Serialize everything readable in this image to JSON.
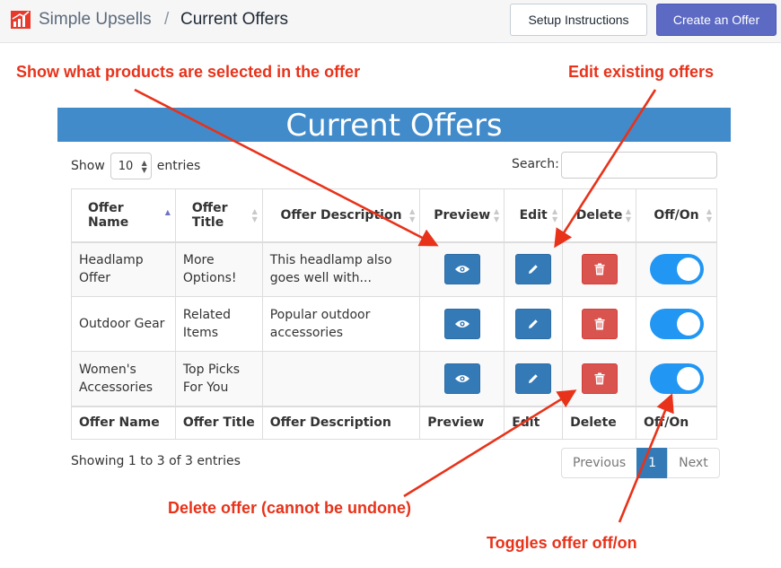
{
  "header": {
    "brand": "Simple Upsells",
    "separator": "/",
    "page_title": "Current Offers",
    "setup_label": "Setup Instructions",
    "create_label": "Create an Offer"
  },
  "banner": {
    "title": "Current Offers"
  },
  "controls": {
    "show_label": "Show",
    "page_length": "10",
    "entries_label": "entries",
    "search_label": "Search:",
    "search_value": ""
  },
  "table": {
    "headers": [
      "Offer Name",
      "Offer Title",
      "Offer Description",
      "Preview",
      "Edit",
      "Delete",
      "Off/On"
    ],
    "rows": [
      {
        "name": "Headlamp Offer",
        "title": "More Options!",
        "description": "This headlamp also goes well with...",
        "enabled": true
      },
      {
        "name": "Outdoor Gear",
        "title": "Related Items",
        "description": "Popular outdoor accessories",
        "enabled": true
      },
      {
        "name": "Women's Accessories",
        "title": "Top Picks For You",
        "description": "",
        "enabled": true
      }
    ],
    "sort_column": "Offer Name",
    "sort_direction": "ascending"
  },
  "footer": {
    "info": "Showing 1 to 3 of 3 entries",
    "previous_label": "Previous",
    "current_page": "1",
    "next_label": "Next"
  },
  "annotations": {
    "preview": "Show what products are selected in the offer",
    "edit": "Edit existing offers",
    "delete": "Delete offer (cannot be undone)",
    "toggle": "Toggles offer off/on"
  },
  "colors": {
    "banner": "#428bca",
    "primary_button": "#5c6ac4",
    "action_blue": "#337ab7",
    "action_red": "#d9534f",
    "toggle_on": "#2196f3",
    "annotation": "#e8321a"
  },
  "icons": {
    "logo": "chart-logo-icon",
    "preview": "eye-icon",
    "edit": "pencil-icon",
    "delete": "trash-icon"
  }
}
